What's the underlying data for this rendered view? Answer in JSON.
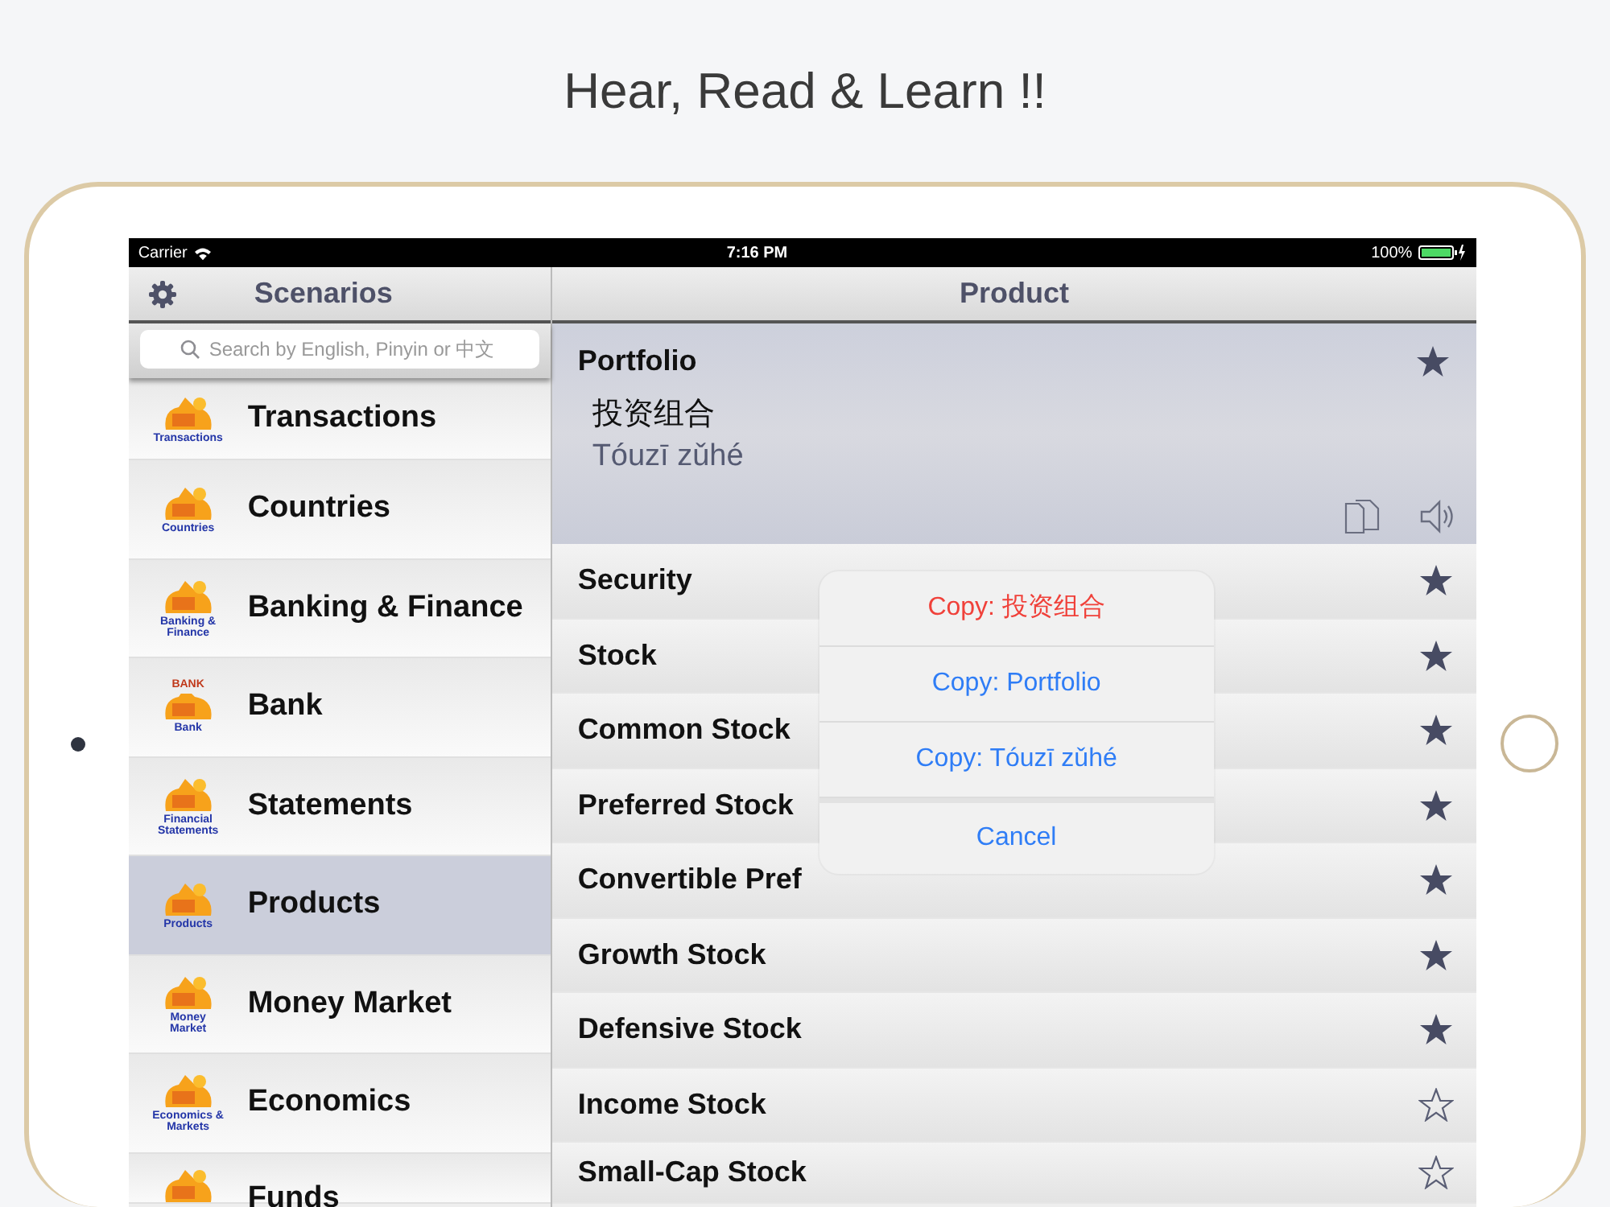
{
  "headline": "Hear, Read & Learn !!",
  "status_bar": {
    "carrier": "Carrier",
    "time": "7:16 PM",
    "battery": "100%"
  },
  "sidebar": {
    "title": "Scenarios",
    "search": {
      "placeholder": "Search by English, Pinyin or 中文"
    },
    "items": [
      {
        "label": "Transactions",
        "icon_caption": "Transactions",
        "selected": false
      },
      {
        "label": "Countries",
        "icon_caption": "Countries",
        "selected": false
      },
      {
        "label": "Banking & Finance",
        "icon_caption": "Banking & Finance",
        "selected": false
      },
      {
        "label": "Bank",
        "icon_caption": "Bank",
        "sign": "BANK",
        "selected": false
      },
      {
        "label": "Statements",
        "icon_caption": "Financial Statements",
        "selected": false
      },
      {
        "label": "Products",
        "icon_caption": "Products",
        "selected": true
      },
      {
        "label": "Money Market",
        "icon_caption": "Money Market",
        "selected": false
      },
      {
        "label": "Economics",
        "icon_caption": "Economics & Markets",
        "selected": false
      },
      {
        "label": "Funds",
        "selected": false
      }
    ]
  },
  "detail": {
    "title": "Product",
    "entry": {
      "english": "Portfolio",
      "chinese": "投资组合",
      "pinyin": "Tóuzī zǔhé",
      "starred": true
    },
    "terms": [
      {
        "label": "Security",
        "starred": true
      },
      {
        "label": "Stock",
        "starred": true
      },
      {
        "label": "Common Stock",
        "starred": true
      },
      {
        "label": "Preferred Stock",
        "starred": true
      },
      {
        "label": "Convertible Pref",
        "starred": true
      },
      {
        "label": "Growth Stock",
        "starred": true
      },
      {
        "label": "Defensive Stock",
        "starred": true
      },
      {
        "label": "Income Stock",
        "starred": false
      },
      {
        "label": "Small-Cap Stock",
        "starred": false
      }
    ]
  },
  "action_sheet": {
    "options": [
      {
        "label": "Copy: 投资组合",
        "kind": "destructive"
      },
      {
        "label": "Copy: Portfolio",
        "kind": "default"
      },
      {
        "label": "Copy: Tóuzī zǔhé",
        "kind": "default"
      },
      {
        "label": "Cancel",
        "kind": "cancel"
      }
    ]
  }
}
